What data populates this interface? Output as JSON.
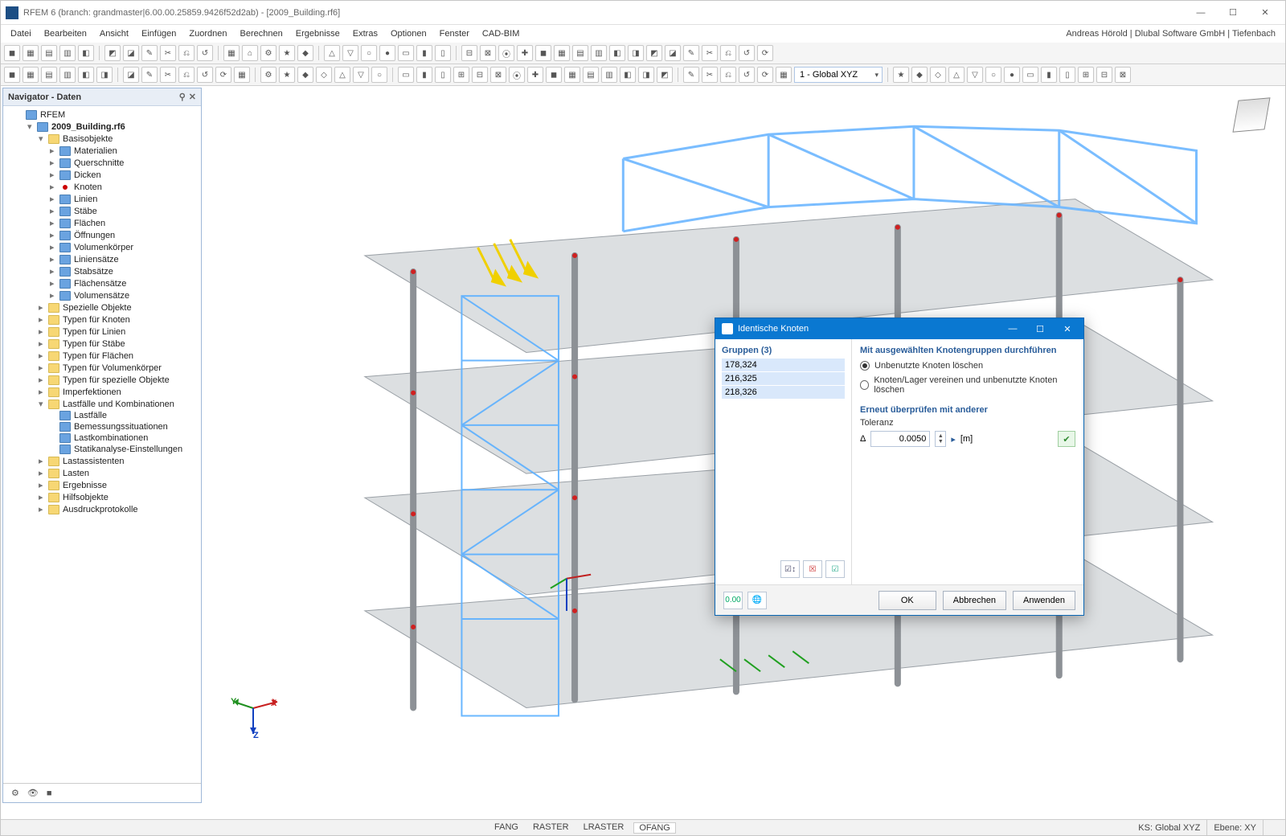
{
  "window": {
    "title": "RFEM 6 (branch: grandmaster|6.00.00.25859.9426f52d2ab) - [2009_Building.rf6]"
  },
  "menu": {
    "items": [
      "Datei",
      "Bearbeiten",
      "Ansicht",
      "Einfügen",
      "Zuordnen",
      "Berechnen",
      "Ergebnisse",
      "Extras",
      "Optionen",
      "Fenster",
      "CAD-BIM"
    ],
    "user_info": "Andreas Hörold | Dlubal Software GmbH | Tiefenbach"
  },
  "toolbar": {
    "coord_system": "1 - Global XYZ"
  },
  "navigator": {
    "title": "Navigator - Daten",
    "root": "RFEM",
    "file": "2009_Building.rf6",
    "basis": "Basisobjekte",
    "basis_sub": [
      "Materialien",
      "Querschnitte",
      "Dicken",
      "Knoten",
      "Linien",
      "Stäbe",
      "Flächen",
      "Öffnungen",
      "Volumenkörper",
      "Liniensätze",
      "Stabsätze",
      "Flächensätze",
      "Volumensätze"
    ],
    "groups": [
      "Spezielle Objekte",
      "Typen für Knoten",
      "Typen für Linien",
      "Typen für Stäbe",
      "Typen für Flächen",
      "Typen für Volumenkörper",
      "Typen für spezielle Objekte",
      "Imperfektionen"
    ],
    "lc": "Lastfälle und Kombinationen",
    "lc_sub": [
      "Lastfälle",
      "Bemessungssituationen",
      "Lastkombinationen",
      "Statikanalyse-Einstellungen"
    ],
    "after_lc": [
      "Lastassistenten",
      "Lasten",
      "Ergebnisse",
      "Hilfsobjekte",
      "Ausdruckprotokolle"
    ]
  },
  "dialog": {
    "title": "Identische Knoten",
    "groups_header": "Gruppen (3)",
    "groups": [
      "178,324",
      "216,325",
      "218,326"
    ],
    "section1": "Mit ausgewählten Knotengruppen durchführen",
    "opt1": "Unbenutzte Knoten löschen",
    "opt2": "Knoten/Lager vereinen und unbenutzte Knoten löschen",
    "section2": "Erneut überprüfen mit anderer",
    "tol_label": "Toleranz",
    "tol_delta": "Δ",
    "tol_value": "0.0050",
    "tol_unit": "[m]",
    "ok": "OK",
    "cancel": "Abbrechen",
    "apply": "Anwenden",
    "footer_icon1": "0.00"
  },
  "status": {
    "snaps": [
      "FANG",
      "RASTER",
      "LRASTER",
      "OFANG"
    ],
    "ks": "KS: Global XYZ",
    "ebene": "Ebene: XY"
  },
  "axes": {
    "x": "X",
    "y": "Y",
    "z": "Z"
  }
}
